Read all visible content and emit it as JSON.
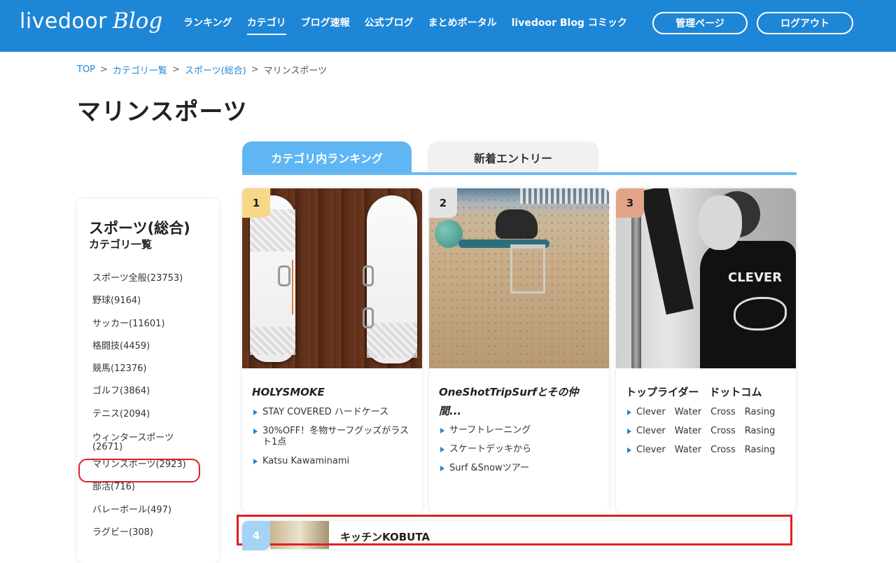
{
  "header": {
    "logo_brand": "livedoor",
    "logo_blog": "Blog",
    "nav": [
      "ランキング",
      "カテゴリ",
      "ブログ速報",
      "公式ブログ",
      "まとめポータル",
      "livedoor Blog コミック"
    ],
    "admin_button": "管理ページ",
    "logout_button": "ログアウト"
  },
  "breadcrumb": {
    "top": "TOP",
    "categories": "カテゴリ一覧",
    "sports": "スポーツ(総合)",
    "current": "マリンスポーツ",
    "separator": ">"
  },
  "page_title": "マリンスポーツ",
  "tabs": {
    "ranking": "カテゴリ内ランキング",
    "new_entries": "新着エントリー"
  },
  "sidebar": {
    "title": "スポーツ(総合)",
    "subtitle": "カテゴリ一覧",
    "items": [
      "スポーツ全般(23753)",
      "野球(9164)",
      "サッカー(11601)",
      "格闘技(4459)",
      "競馬(12376)",
      "ゴルフ(3864)",
      "テニス(2094)",
      "ウィンタースポーツ(2671)",
      "マリンスポーツ(2923)",
      "部活(716)",
      "バレーボール(497)",
      "ラグビー(308)"
    ]
  },
  "cards": [
    {
      "rank": "1",
      "title": "HOLYSMOKE",
      "entries": [
        "STAY COVERED ハードケース",
        "30%OFF！冬物サーフグッズがラスト1点",
        "Katsu Kawaminami"
      ]
    },
    {
      "rank": "2",
      "title": "OneShotTripSurfとその仲間...",
      "entries": [
        "サーフトレーニング",
        "スケートデッキから",
        "Surf &Snowツアー"
      ]
    },
    {
      "rank": "3",
      "title": "トップライダー　ドットコム",
      "entries": [
        "Clever　Water　Cross　Rasing",
        "Clever　Water　Cross　Rasing",
        "Clever　Water　Cross　Rasing"
      ]
    }
  ],
  "row4": {
    "rank": "4",
    "title": "キッチンKOBUTA"
  },
  "thumb_text": {
    "shirt": "CLEVER"
  }
}
